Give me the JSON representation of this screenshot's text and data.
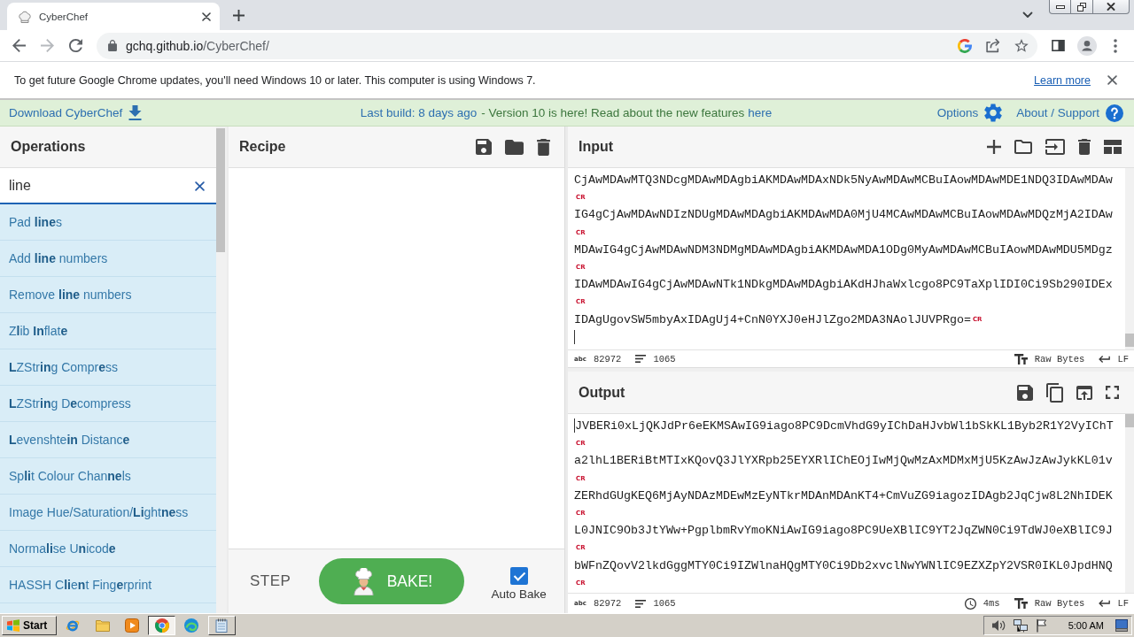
{
  "browser": {
    "tabs": [
      {
        "title": "CyberChef",
        "selected": true
      }
    ],
    "address": {
      "host": "gchq.github.io",
      "path": "/CyberChef/"
    }
  },
  "infobar": {
    "message": "To get future Google Chrome updates, you'll need Windows 10 or later. This computer is using Windows 7.",
    "link": "Learn more"
  },
  "banner": {
    "download": "Download CyberChef",
    "build": "Last build: 8 days ago",
    "notice": "- Version 10 is here! Read about the new features",
    "notice_link": "here",
    "options": "Options",
    "about": "About / Support"
  },
  "operations": {
    "title": "Operations",
    "search": {
      "value": "line"
    },
    "items": [
      {
        "label": "Pad **line**s"
      },
      {
        "label": "Add **line** numbers"
      },
      {
        "label": "Remove **line** numbers"
      },
      {
        "label": "Z**l**ib **In**flat**e**"
      },
      {
        "label": "**L**ZStr**in**g Compr**e**ss"
      },
      {
        "label": "**L**ZStr**in**g D**e**compress"
      },
      {
        "label": "**L**evenshte**in** Distanc**e**"
      },
      {
        "label": "Sp**li**t Colour Chan**ne**ls"
      },
      {
        "label": "Image Hue/Saturation/**Li**ght**ne**ss"
      },
      {
        "label": "Norma**li**se U**n**icod**e**"
      },
      {
        "label": "HASSH C**li**e**n**t Fing**e**rprint"
      }
    ]
  },
  "recipe": {
    "title": "Recipe",
    "step": "STEP",
    "bake": "BAKE!",
    "auto_bake": {
      "label": "Auto Bake",
      "checked": true
    }
  },
  "input": {
    "title": "Input",
    "lines": [
      {
        "text": "CjAwMDAwMTQ3NDcgMDAwMDAgbiAKMDAwMDAxNDk5NyAwMDAwMCBuIAowMDAwMDE1NDQ3IDAwMDAw",
        "eol": "CR"
      },
      {
        "text": "IG4gCjAwMDAwNDIzNDUgMDAwMDAgbiAKMDAwMDA0MjU4MCAwMDAwMCBuIAowMDAwMDQzMjA2IDAw",
        "eol": "CR"
      },
      {
        "text": "MDAwIG4gCjAwMDAwNDM3NDMgMDAwMDAgbiAKMDAwMDA1ODg0MyAwMDAwMCBuIAowMDAwMDU5MDgz",
        "eol": "CR"
      },
      {
        "text": "IDAwMDAwIG4gCjAwMDAwNTk1NDkgMDAwMDAgbiAKdHJhaWxlcgo8PC9TaXplIDI0Ci9Sb290IDEx",
        "eol": "CR"
      },
      {
        "text": "IDAgUgovSW5mbyAxIDAgUj4+CnN0YXJ0eHJlZgo2MDA3NAolJUVPRgo=",
        "eol": "CR"
      }
    ],
    "status": {
      "length_icon": "abc",
      "length": "82972",
      "lines": "1065",
      "encoding": "Raw Bytes",
      "eol": "LF"
    }
  },
  "output": {
    "title": "Output",
    "lines": [
      {
        "text": "JVBERi0xLjQKJdPr6eEKMSAwIG9iago8PC9DcmVhdG9yIChDaHJvbWl1bSkKL1Byb2R1Y2VyIChT",
        "eol": "CR"
      },
      {
        "text": "a2lhL1BERiBtMTIxKQovQ3JlYXRpb25EYXRlIChEOjIwMjQwMzAxMDMxMjU5KzAwJzAwJykKL01v",
        "eol": "CR"
      },
      {
        "text": "ZERhdGUgKEQ6MjAyNDAzMDEwMzEyNTkrMDAnMDAnKT4+CmVuZG9iagozIDAgb2JqCjw8L2NhIDEK",
        "eol": "CR"
      },
      {
        "text": "L0JNIC9Ob3JtYWw+PgplbmRvYmoKNiAwIG9iago8PC9UeXBlIC9YT2JqZWN0Ci9TdWJ0eXBlIC9J",
        "eol": "CR"
      },
      {
        "text": "bWFnZQovV2lkdGggMTY0Ci9IZWlnaHQgMTY0Ci9Db2xvclNwYWNlIC9EZXZpY2VSR0IKL0JpdHNQ",
        "eol": "CR"
      }
    ],
    "status": {
      "length_icon": "abc",
      "length": "82972",
      "lines": "1065",
      "time": "4ms",
      "encoding": "Raw Bytes",
      "eol": "LF"
    }
  },
  "taskbar": {
    "start": "Start",
    "apps": [
      {
        "open": false,
        "selected": false
      },
      {
        "open": false,
        "selected": false
      },
      {
        "open": false,
        "selected": false
      },
      {
        "open": true,
        "selected": true
      },
      {
        "open": false,
        "selected": false
      },
      {
        "open": true,
        "selected": false
      }
    ],
    "clock": "5:00 AM"
  }
}
